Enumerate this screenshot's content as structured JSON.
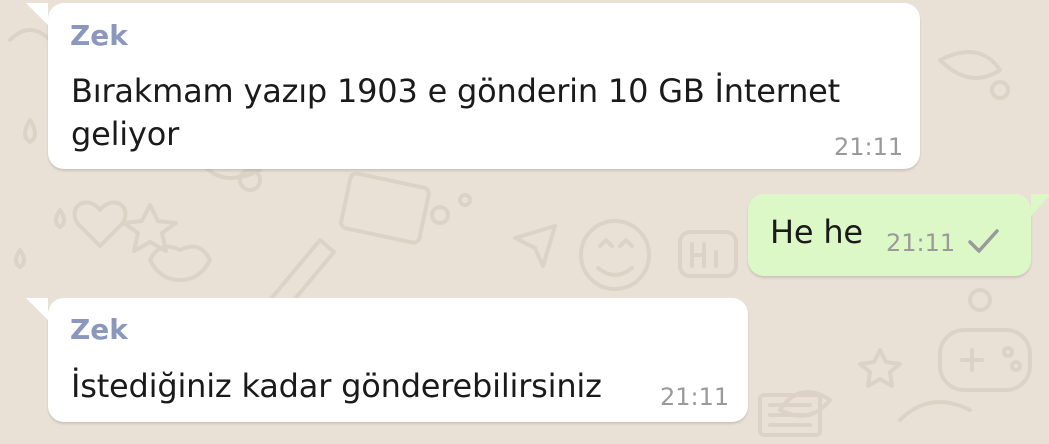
{
  "chat": {
    "messages": [
      {
        "direction": "incoming",
        "sender": "Zek",
        "lines": [
          "Bırakmam yazıp 1903 e gönderin 10 GB İnternet",
          "geliyor"
        ],
        "time": "21:11"
      },
      {
        "direction": "outgoing",
        "text": "He he",
        "time": "21:11",
        "status_icon": "single-check-icon"
      },
      {
        "direction": "incoming",
        "sender": "Zek",
        "text": "İstediğiniz kadar gönderebilirsiniz",
        "time": "21:11"
      }
    ]
  },
  "colors": {
    "wallpaper": "#e9e1d6",
    "incoming_bubble": "#ffffff",
    "outgoing_bubble": "#dcf8c6",
    "sender_name": "#8c97bd",
    "timestamp": "#9a9a9a"
  }
}
